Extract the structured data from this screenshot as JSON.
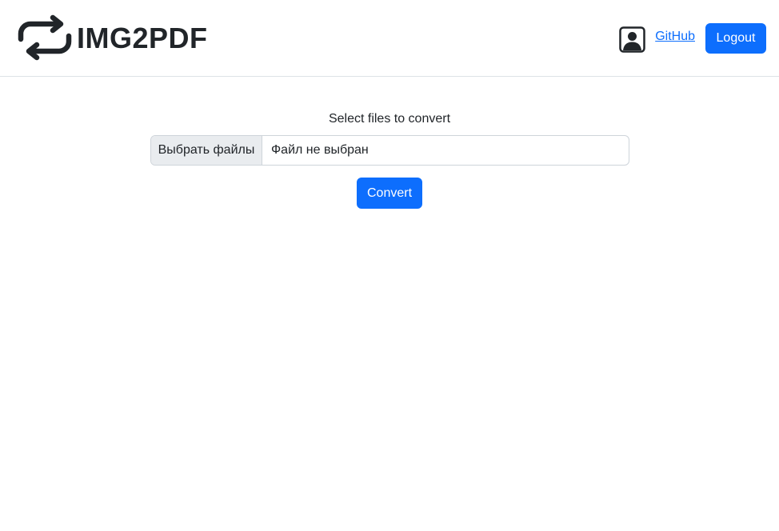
{
  "header": {
    "brand_icon": "repeat-arrows-icon",
    "brand_title": "IMG2PDF",
    "avatar_icon": "person-square-icon",
    "github_label": "GitHub",
    "logout_label": "Logout"
  },
  "main": {
    "select_label": "Select files to convert",
    "file_input": {
      "choose_label": "Выбрать файлы",
      "status_text": "Файл не выбран"
    },
    "convert_label": "Convert"
  },
  "colors": {
    "primary": "#0d6efd",
    "text": "#212529",
    "border": "#dee2e6",
    "file_button_bg": "#e9ecef"
  }
}
